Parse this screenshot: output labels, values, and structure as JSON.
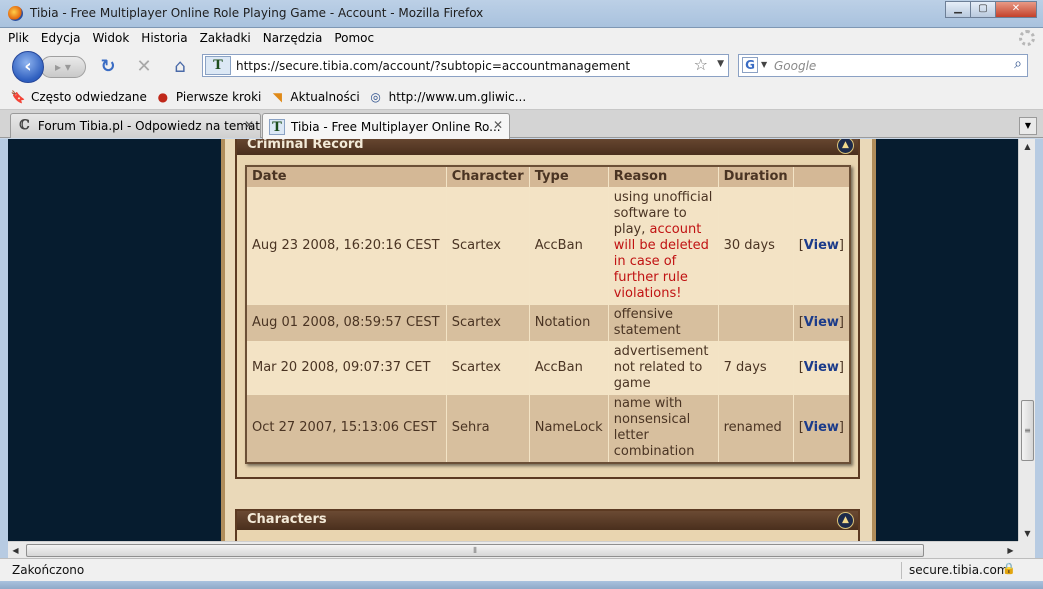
{
  "window": {
    "title": "Tibia - Free Multiplayer Online Role Playing Game - Account - Mozilla Firefox",
    "minimize": "▁",
    "maximize": "▢",
    "close": "✕"
  },
  "menu": [
    "Plik",
    "Edycja",
    "Widok",
    "Historia",
    "Zakładki",
    "Narzędzia",
    "Pomoc"
  ],
  "nav": {
    "url": "https://secure.tibia.com/account/?subtopic=accountmanagement",
    "search_placeholder": "Google",
    "search_engine_letter": "G",
    "site_icon_letter": "T"
  },
  "bookmarks": [
    {
      "label": "Często odwiedzane",
      "icon": "bookmark-icon",
      "glyph": "🔖"
    },
    {
      "label": "Pierwsze kroki",
      "icon": "firefox-icon",
      "glyph": "●"
    },
    {
      "label": "Aktualności",
      "icon": "rss-icon",
      "glyph": "◥"
    },
    {
      "label": "http://www.um.gliwic...",
      "icon": "page-icon",
      "glyph": "◎"
    }
  ],
  "tabs": [
    {
      "label": "Forum Tibia.pl - Odpowiedz na temat",
      "active": false,
      "close": "✕"
    },
    {
      "label": "Tibia - Free Multiplayer Online Ro...",
      "active": true,
      "close": "✕"
    }
  ],
  "criminal_record": {
    "title": "Criminal Record",
    "headers": [
      "Date",
      "Character",
      "Type",
      "Reason",
      "Duration",
      ""
    ],
    "rows": [
      {
        "date": "Aug 23 2008, 16:20:16 CEST",
        "character": "Scartex",
        "type": "AccBan",
        "reason": "using unofficial software to play,",
        "reason_warning": " account will be deleted in case of further rule violations!",
        "duration": "30 days",
        "view": "View"
      },
      {
        "date": "Aug 01 2008, 08:59:57 CEST",
        "character": "Scartex",
        "type": "Notation",
        "reason": "offensive statement",
        "reason_warning": "",
        "duration": "",
        "view": "View"
      },
      {
        "date": "Mar 20 2008, 09:07:37 CET",
        "character": "Scartex",
        "type": "AccBan",
        "reason": "advertisement not related to game",
        "reason_warning": "",
        "duration": "7 days",
        "view": "View"
      },
      {
        "date": "Oct 27 2007, 15:13:06 CEST",
        "character": "Sehra",
        "type": "NameLock",
        "reason": "name with nonsensical letter combination",
        "reason_warning": "",
        "duration": "renamed",
        "view": "View"
      }
    ]
  },
  "characters": {
    "title": "Characters"
  },
  "status": {
    "text": "Zakończono",
    "site": "secure.tibia.com"
  },
  "colors": {
    "page_background": "#061c2f",
    "box_header": "#5a3b27",
    "warning_text": "#c01212",
    "link": "#1b3b8a"
  }
}
